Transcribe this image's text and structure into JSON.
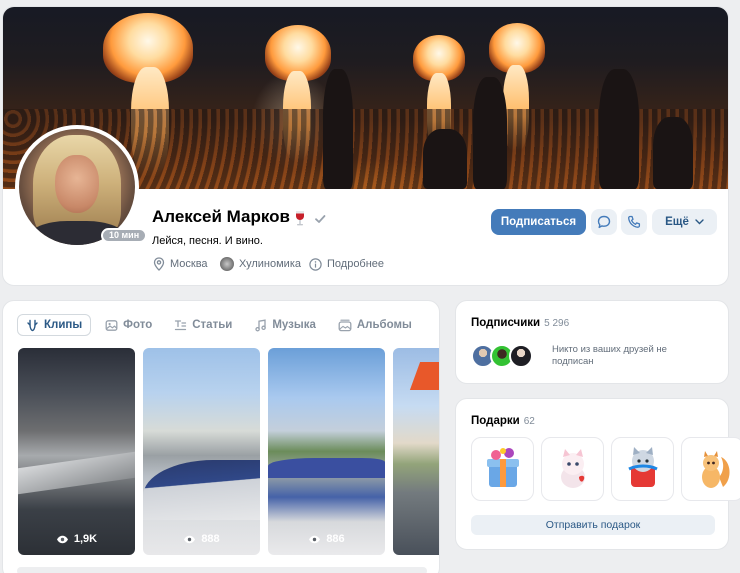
{
  "profile": {
    "name": "Алексей Марков",
    "status": "Лейся, песня. И вино.",
    "online_badge": "10 мин",
    "info": {
      "city": "Москва",
      "group": "Хулиномика",
      "more": "Подробнее"
    },
    "actions": {
      "subscribe": "Подписаться",
      "more": "Ещё"
    }
  },
  "content": {
    "tabs": [
      {
        "label": "Клипы",
        "icon": "clips-icon",
        "active": true
      },
      {
        "label": "Фото",
        "icon": "photo-icon",
        "active": false
      },
      {
        "label": "Статьи",
        "icon": "articles-icon",
        "active": false
      },
      {
        "label": "Музыка",
        "icon": "music-icon",
        "active": false
      },
      {
        "label": "Альбомы",
        "icon": "albums-icon",
        "active": false
      }
    ],
    "clips": [
      {
        "views": "1,9K"
      },
      {
        "views": "888"
      },
      {
        "views": "886"
      },
      {
        "views": ""
      }
    ]
  },
  "followers": {
    "title": "Подписчики",
    "count": "5 296",
    "note": "Никто из ваших друзей не подписан"
  },
  "gifts": {
    "title": "Подарки",
    "count": "62",
    "send_label": "Отправить подарок"
  },
  "colors": {
    "accent": "#447bba",
    "link": "#2a5885",
    "secondary_button": "#ebf0f5",
    "page_background": "#edeef0"
  }
}
